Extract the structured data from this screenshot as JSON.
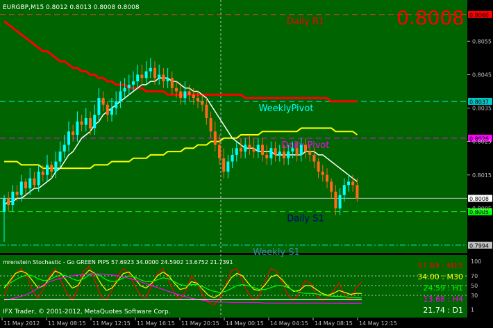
{
  "header": {
    "symbol_line": "EURGBP,M15  0.8012 0.8013 0.8008 0.8008",
    "big_price": "0.8008"
  },
  "colors": {
    "background": "#006400",
    "axis_panel": "#000000",
    "bull": "#00ffff",
    "bear": "#ff6a1a",
    "ma_slow": "#ffff00",
    "ma_fast": "#ffffff",
    "ma_daily": "#ff0000",
    "weekly_pivot_line": "#00ffff",
    "daily_pivot_line": "#ff00ff",
    "grid": "#c0c0c0",
    "big_price": "#ff0000"
  },
  "levels": [
    {
      "label": "Daily R1",
      "price": 0.8063,
      "tag": "0.8060",
      "tag_color": "#ff0000",
      "text_color": "#ff0000",
      "line_color": "#ff4040",
      "style": "dash"
    },
    {
      "label": "WeeklyPivot",
      "price": 0.8037,
      "tag": "0.8037",
      "tag_color": "#00c8c8",
      "text_color": "#00ffff",
      "line_color": "#00ffff",
      "style": "dash"
    },
    {
      "label": "Daily Pivot",
      "price": 0.8026,
      "tag": "0.8026",
      "tag_color": "#ff00ff",
      "text_color": "#ff00ff",
      "line_color": "#ff00ff",
      "style": "dash"
    },
    {
      "label": "Daily S1",
      "price": 0.8004,
      "tag": "0.8005",
      "tag_color": "#00ff00",
      "text_color": "#000080",
      "line_color": "#00ff00",
      "style": "dash"
    },
    {
      "label": "Weekly S1",
      "price": 0.7994,
      "tag": "0.7994",
      "tag_color": "#c0c0c0",
      "text_color": "#4682b4",
      "line_color": "#00ffff",
      "style": "dashdot"
    }
  ],
  "current_price": {
    "price": 0.8008,
    "tag": "0.8008"
  },
  "price_axis_ticks": [
    "0.8055",
    "0.8045",
    "0.8035",
    "0.8025",
    "0.8015",
    "0.8005"
  ],
  "time_axis_labels": [
    "11 May 2012",
    "11 May 08:15",
    "11 May 12:15",
    "11 May 16:15",
    "11 May 20:15",
    "14 May 00:15",
    "14 May 04:15",
    "14 May 08:15",
    "14 May 12:15"
  ],
  "chart_data": {
    "type": "candlestick",
    "symbol": "EURGBP",
    "timeframe": "M15",
    "ylim": [
      0.79925,
      0.80665
    ],
    "open": [
      0.8004,
      0.8008,
      0.8006,
      0.801,
      0.8009,
      0.8013,
      0.8011,
      0.8014,
      0.8012,
      0.8016,
      0.8015,
      0.8018,
      0.8016,
      0.8019,
      0.8022,
      0.8024,
      0.8028,
      0.8027,
      0.8031,
      0.803,
      0.8032,
      0.8029,
      0.8033,
      0.8038,
      0.8036,
      0.8033,
      0.8035,
      0.8037,
      0.804,
      0.8041,
      0.8042,
      0.8043,
      0.8045,
      0.8044,
      0.8046,
      0.8047,
      0.8044,
      0.8045,
      0.8043,
      0.8044,
      0.8041,
      0.804,
      0.8038,
      0.804,
      0.8039,
      0.8038,
      0.8037,
      0.8036,
      0.8032,
      0.8028,
      0.8024,
      0.802,
      0.8016,
      0.8019,
      0.8021,
      0.8023,
      0.8022,
      0.8024,
      0.8023,
      0.8022,
      0.8024,
      0.8021,
      0.802,
      0.8023,
      0.8021,
      0.8022,
      0.802,
      0.8022,
      0.8023,
      0.8021,
      0.8024,
      0.8022,
      0.8021,
      0.8019,
      0.8016,
      0.8015,
      0.8013,
      0.801,
      0.8005,
      0.8009,
      0.8012,
      0.8013,
      0.8012
    ],
    "close": [
      0.8008,
      0.8006,
      0.801,
      0.8009,
      0.8013,
      0.8011,
      0.8014,
      0.8012,
      0.8016,
      0.8015,
      0.8018,
      0.8016,
      0.8019,
      0.8022,
      0.8024,
      0.8028,
      0.8027,
      0.8031,
      0.803,
      0.8032,
      0.8029,
      0.8033,
      0.8038,
      0.8036,
      0.8033,
      0.8035,
      0.8037,
      0.804,
      0.8041,
      0.8042,
      0.8043,
      0.8045,
      0.8044,
      0.8046,
      0.8047,
      0.8044,
      0.8045,
      0.8043,
      0.8044,
      0.8041,
      0.804,
      0.8038,
      0.804,
      0.8039,
      0.8038,
      0.8037,
      0.8036,
      0.8032,
      0.8028,
      0.8024,
      0.802,
      0.8016,
      0.8019,
      0.8021,
      0.8023,
      0.8022,
      0.8024,
      0.8023,
      0.8022,
      0.8024,
      0.8021,
      0.802,
      0.8023,
      0.8021,
      0.8022,
      0.802,
      0.8022,
      0.8023,
      0.8021,
      0.8024,
      0.8022,
      0.8021,
      0.8019,
      0.8016,
      0.8015,
      0.8013,
      0.801,
      0.8005,
      0.8009,
      0.8012,
      0.8013,
      0.8012,
      0.8008
    ],
    "high": [
      0.8009,
      0.801,
      0.8012,
      0.8012,
      0.8015,
      0.8014,
      0.8017,
      0.8016,
      0.8018,
      0.8018,
      0.8021,
      0.8019,
      0.8022,
      0.8025,
      0.8027,
      0.8031,
      0.803,
      0.8034,
      0.8033,
      0.8035,
      0.8034,
      0.8036,
      0.8041,
      0.804,
      0.8037,
      0.8038,
      0.804,
      0.8043,
      0.8044,
      0.8045,
      0.8046,
      0.8048,
      0.8048,
      0.8049,
      0.805,
      0.8049,
      0.8048,
      0.8047,
      0.8047,
      0.8046,
      0.8043,
      0.8042,
      0.8043,
      0.8042,
      0.8041,
      0.804,
      0.8039,
      0.8038,
      0.8034,
      0.8031,
      0.8027,
      0.8023,
      0.8021,
      0.8023,
      0.8025,
      0.8026,
      0.8026,
      0.8027,
      0.8026,
      0.8026,
      0.8026,
      0.8024,
      0.8025,
      0.8025,
      0.8024,
      0.8024,
      0.8024,
      0.8025,
      0.8025,
      0.8026,
      0.8026,
      0.8024,
      0.8023,
      0.802,
      0.8018,
      0.8017,
      0.8014,
      0.8012,
      0.8011,
      0.8014,
      0.8015,
      0.8015,
      0.8014
    ],
    "low": [
      0.7995,
      0.8004,
      0.8004,
      0.8007,
      0.8007,
      0.8009,
      0.8009,
      0.8011,
      0.801,
      0.8013,
      0.8013,
      0.8014,
      0.8014,
      0.8017,
      0.802,
      0.8022,
      0.8025,
      0.8025,
      0.8028,
      0.8028,
      0.8027,
      0.8027,
      0.8031,
      0.8034,
      0.8031,
      0.8031,
      0.8033,
      0.8035,
      0.8038,
      0.8039,
      0.804,
      0.8041,
      0.8042,
      0.8042,
      0.8044,
      0.8042,
      0.8042,
      0.8041,
      0.8041,
      0.8039,
      0.8038,
      0.8036,
      0.8036,
      0.8037,
      0.8036,
      0.8035,
      0.8034,
      0.803,
      0.8026,
      0.8022,
      0.8018,
      0.8014,
      0.8014,
      0.8017,
      0.8019,
      0.802,
      0.802,
      0.8021,
      0.802,
      0.802,
      0.8019,
      0.8018,
      0.8018,
      0.8019,
      0.8019,
      0.8018,
      0.8018,
      0.802,
      0.8019,
      0.8019,
      0.802,
      0.8019,
      0.8017,
      0.8014,
      0.8013,
      0.8011,
      0.8008,
      0.8003,
      0.8003,
      0.8007,
      0.801,
      0.801,
      0.8007
    ],
    "ma_fast": [
      0.8006,
      0.8007,
      0.8007,
      0.8008,
      0.8008,
      0.8009,
      0.801,
      0.8011,
      0.8011,
      0.8012,
      0.8013,
      0.8014,
      0.8016,
      0.8017,
      0.8019,
      0.8021,
      0.8022,
      0.8024,
      0.8026,
      0.8027,
      0.8028,
      0.803,
      0.8031,
      0.8033,
      0.8034,
      0.8035,
      0.8036,
      0.8037,
      0.8038,
      0.8039,
      0.804,
      0.8041,
      0.8042,
      0.8042,
      0.8043,
      0.8043,
      0.8044,
      0.8044,
      0.8044,
      0.8043,
      0.8043,
      0.8042,
      0.8041,
      0.8041,
      0.804,
      0.804,
      0.8039,
      0.8038,
      0.8036,
      0.8034,
      0.8032,
      0.803,
      0.8028,
      0.8026,
      0.8025,
      0.8024,
      0.8023,
      0.8023,
      0.8023,
      0.8022,
      0.8022,
      0.8022,
      0.8022,
      0.8021,
      0.8021,
      0.8021,
      0.8021,
      0.8021,
      0.8021,
      0.8021,
      0.8022,
      0.8022,
      0.8022,
      0.8021,
      0.8021,
      0.802,
      0.8019,
      0.8018,
      0.8017,
      0.8016,
      0.8015,
      0.8014,
      0.8013
    ],
    "ma_slow": [
      0.8019,
      0.8019,
      0.8019,
      0.8019,
      0.8018,
      0.8018,
      0.8018,
      0.8018,
      0.8018,
      0.8017,
      0.8017,
      0.8017,
      0.8017,
      0.8017,
      0.8017,
      0.8017,
      0.8017,
      0.8017,
      0.8017,
      0.8017,
      0.8017,
      0.8018,
      0.8018,
      0.8018,
      0.8018,
      0.8019,
      0.8019,
      0.8019,
      0.8019,
      0.8019,
      0.802,
      0.802,
      0.802,
      0.802,
      0.8021,
      0.8021,
      0.8021,
      0.8021,
      0.8022,
      0.8022,
      0.8022,
      0.8022,
      0.8023,
      0.8023,
      0.8023,
      0.8024,
      0.8024,
      0.8024,
      0.8025,
      0.8025,
      0.8025,
      0.8026,
      0.8026,
      0.8026,
      0.8026,
      0.8027,
      0.8027,
      0.8027,
      0.8027,
      0.8027,
      0.8028,
      0.8028,
      0.8028,
      0.8028,
      0.8028,
      0.8028,
      0.8028,
      0.8028,
      0.8028,
      0.8029,
      0.8029,
      0.8029,
      0.8029,
      0.8029,
      0.8029,
      0.8029,
      0.8029,
      0.8028,
      0.8028,
      0.8028,
      0.8028,
      0.8028,
      0.8027
    ],
    "ma_daily": [
      0.8061,
      0.806,
      0.8059,
      0.8058,
      0.8057,
      0.8056,
      0.8055,
      0.8054,
      0.8053,
      0.8052,
      0.8052,
      0.8051,
      0.805,
      0.8049,
      0.8049,
      0.8048,
      0.8047,
      0.8047,
      0.8046,
      0.8046,
      0.8045,
      0.8045,
      0.8044,
      0.8044,
      0.8043,
      0.8043,
      0.8042,
      0.8042,
      0.8042,
      0.8041,
      0.8041,
      0.8041,
      0.8041,
      0.804,
      0.804,
      0.804,
      0.804,
      0.804,
      0.8039,
      0.8039,
      0.8039,
      0.8039,
      0.8039,
      0.8039,
      0.8039,
      0.8039,
      0.8039,
      0.8039,
      0.8039,
      0.8039,
      0.8039,
      0.8039,
      0.8039,
      0.8039,
      0.8039,
      0.8039,
      0.8038,
      0.8038,
      0.8038,
      0.8038,
      0.8038,
      0.8038,
      0.8038,
      0.8038,
      0.8038,
      0.8038,
      0.8038,
      0.8038,
      0.8038,
      0.8038,
      0.8038,
      0.8038,
      0.8038,
      0.8038,
      0.8038,
      0.8038,
      0.8037,
      0.8037,
      0.8037,
      0.8037,
      0.8037,
      0.8037,
      0.8037
    ]
  },
  "indicator": {
    "title": "mrenstein Stochastic - Go GREEN PIPS 57.6923 34.0000 24.5902 13.6752 21.7391",
    "copyright": "IFX Trader, © 2001-2012, MetaQuotes Software Corp.",
    "ylim": [
      0,
      100
    ],
    "ticks": [
      "100",
      "70",
      "50",
      "30",
      "1"
    ],
    "levels": [
      70,
      50,
      30
    ],
    "legend": [
      {
        "text": "57.69 : M15",
        "color": "#ff0000"
      },
      {
        "text": "34.00 : M30",
        "color": "#ffff00"
      },
      {
        "text": "24.59 : H1",
        "color": "#00ff00"
      },
      {
        "text": "13.68 : H4",
        "color": "#ff00ff"
      },
      {
        "text": "21.74 : D1",
        "color": "#ffffff"
      }
    ],
    "series": [
      {
        "name": "M15",
        "color": "#ff0000",
        "values": [
          30,
          55,
          75,
          85,
          70,
          40,
          25,
          45,
          70,
          85,
          60,
          35,
          20,
          45,
          80,
          90,
          60,
          30,
          20,
          40,
          70,
          85,
          75,
          50,
          30,
          25,
          50,
          75,
          85,
          60,
          35,
          20,
          40,
          70,
          55,
          30,
          15,
          10,
          25,
          50,
          80,
          85,
          60,
          35,
          20,
          30,
          60,
          85,
          80,
          55,
          30,
          20,
          35,
          60,
          55,
          30,
          20,
          25,
          40,
          55,
          30,
          20,
          45,
          57.69
        ]
      },
      {
        "name": "M30",
        "color": "#ffff00",
        "values": [
          45,
          60,
          75,
          80,
          75,
          60,
          45,
          50,
          65,
          80,
          75,
          60,
          45,
          50,
          70,
          82,
          75,
          55,
          40,
          45,
          60,
          75,
          78,
          65,
          50,
          45,
          55,
          70,
          78,
          70,
          55,
          42,
          45,
          58,
          55,
          42,
          30,
          25,
          32,
          48,
          66,
          75,
          70,
          55,
          42,
          40,
          52,
          68,
          72,
          62,
          48,
          38,
          40,
          50,
          50,
          42,
          34,
          30,
          34,
          40,
          36,
          32,
          34,
          34.0
        ]
      },
      {
        "name": "H1",
        "color": "#00ff00",
        "values": [
          50,
          55,
          62,
          68,
          72,
          70,
          64,
          60,
          62,
          68,
          72,
          70,
          64,
          60,
          64,
          72,
          75,
          70,
          62,
          58,
          60,
          66,
          70,
          68,
          62,
          58,
          58,
          62,
          66,
          64,
          58,
          52,
          50,
          52,
          52,
          48,
          42,
          38,
          36,
          38,
          44,
          50,
          52,
          50,
          46,
          42,
          42,
          46,
          50,
          50,
          46,
          40,
          36,
          34,
          34,
          33,
          31,
          29,
          28,
          28,
          27,
          26,
          25,
          24.59
        ]
      },
      {
        "name": "H4",
        "color": "#ff00ff",
        "values": [
          20,
          22,
          25,
          28,
          32,
          38,
          45,
          52,
          58,
          62,
          65,
          68,
          70,
          72,
          73,
          74,
          74,
          74,
          73,
          72,
          70,
          68,
          65,
          62,
          58,
          54,
          50,
          46,
          42,
          38,
          34,
          30,
          27,
          24,
          22,
          20,
          18,
          17,
          16,
          16,
          15,
          15,
          15,
          15,
          15,
          15,
          14,
          14,
          14,
          14,
          14,
          14,
          14,
          14,
          14,
          14,
          14,
          13.8,
          13.8,
          13.7,
          13.7,
          13.7,
          13.7,
          13.68
        ]
      },
      {
        "name": "D1",
        "color": "#ffffff",
        "values": [
          22,
          22,
          22,
          22,
          22,
          22,
          22,
          22,
          22,
          22,
          22,
          22,
          22,
          22,
          22,
          22,
          22,
          22,
          22,
          22,
          22,
          22,
          22,
          22,
          22,
          22,
          22,
          22,
          22,
          22,
          22,
          22,
          22,
          22,
          22,
          22,
          22,
          22,
          22,
          22,
          22,
          22,
          22,
          22,
          22,
          22,
          22,
          22,
          22,
          22,
          22,
          22,
          22,
          22,
          22,
          22,
          22,
          22,
          22,
          22,
          22,
          22,
          22,
          21.74
        ]
      }
    ]
  }
}
